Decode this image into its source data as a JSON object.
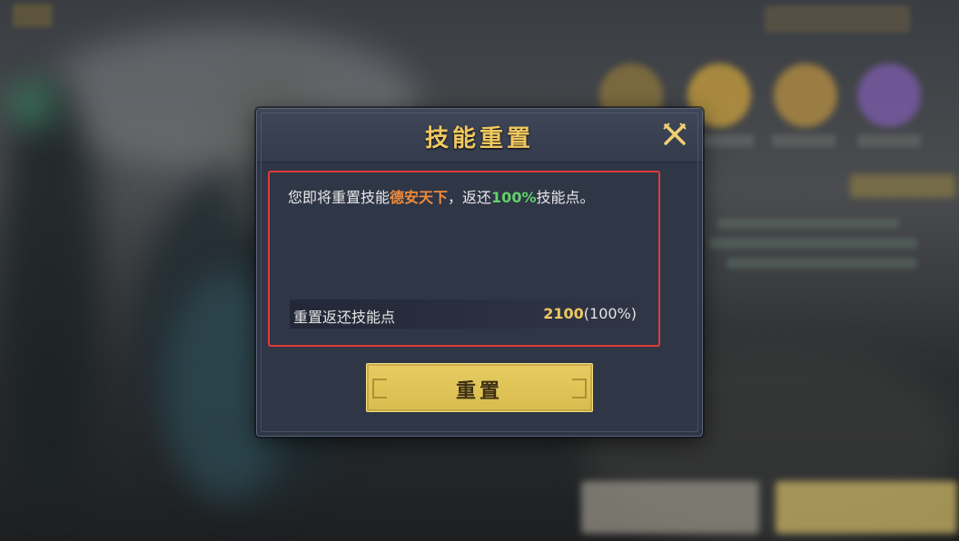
{
  "dialog": {
    "title": "技能重置",
    "message": {
      "prefix": "您即将重置技能",
      "skill_name": "德安天下",
      "middle": "，返还",
      "percent": "100%",
      "suffix": "技能点。"
    },
    "refund": {
      "label": "重置返还技能点",
      "points": "2100",
      "percent": "(100%)"
    },
    "reset_button_label": "重置"
  },
  "colors": {
    "title": "#f0c860",
    "skill_name": "#f08a3a",
    "percent": "#63d06a",
    "highlight_border": "#e03a3a",
    "button": "#e6cc62"
  },
  "icons": {
    "close": "close-icon"
  }
}
